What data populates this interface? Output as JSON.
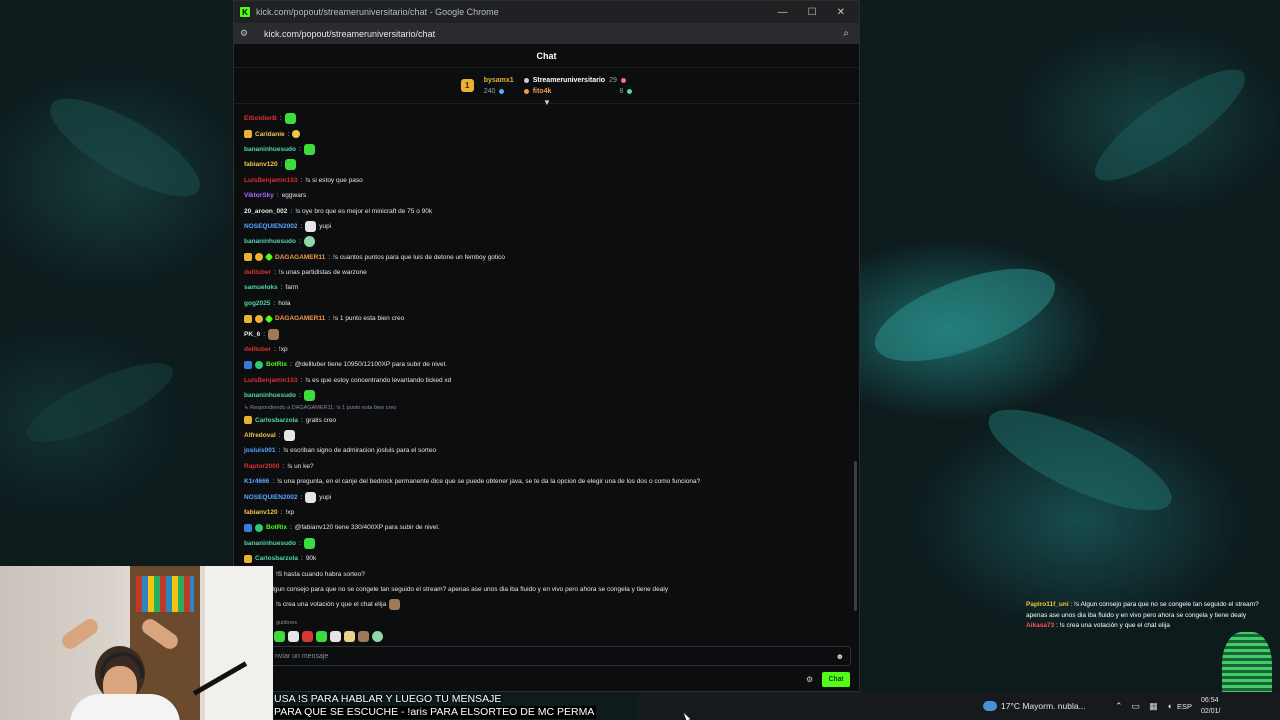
{
  "window": {
    "title": "kick.com/popout/streameruniversitario/chat - Google Chrome",
    "url": "kick.com/popout/streameruniversitario/chat",
    "logo_letter": "K",
    "min": "—",
    "max": "☐",
    "close": "✕"
  },
  "chat": {
    "title": "Chat",
    "leaderboard": {
      "rank": "1",
      "first_name": "bysamx1",
      "first_points": "240",
      "second_name": "Streameruniversitario",
      "second_points": "29",
      "third_name": "fito4k",
      "third_points": "8"
    },
    "messages": [
      {
        "user": "ElSoldierB",
        "color": "#e0302f",
        "text": "",
        "emote": "e-green"
      },
      {
        "user": "Caridanie",
        "color": "#f2c744",
        "text": "",
        "emote": "e-yellow",
        "badges": [
          "b-crown"
        ]
      },
      {
        "user": "bananinhuesudo",
        "color": "#53d6a8",
        "text": "",
        "emote": "e-green"
      },
      {
        "user": "fabianv120",
        "color": "#f2c744",
        "text": "",
        "emote": "e-green"
      },
      {
        "user": "LuisBenjamin103",
        "color": "#e0302f",
        "text": "!s si estoy que paso"
      },
      {
        "user": "ViktorSky",
        "color": "#b36bff",
        "text": "eggwars"
      },
      {
        "user": "20_aroon_002",
        "color": "#e6e6e6",
        "text": "!s oye bro que es mejor el minicraft de 75 o 90k"
      },
      {
        "user": "NOSEQUIEN2002",
        "color": "#5aa8ff",
        "text": "yupi",
        "emote": "e-white"
      },
      {
        "user": "bananinhuesudo",
        "color": "#53d6a8",
        "text": "",
        "emote": "e-teal"
      },
      {
        "user": "DAGAGAMER11",
        "color": "#f2994a",
        "text": "!s cuantos puntos para que luis de detone un femboy gotico",
        "badges": [
          "b-crown",
          "b-coin",
          "b-green"
        ]
      },
      {
        "user": "dellluber",
        "color": "#e0302f",
        "text": "!s unas partidistas de warzone"
      },
      {
        "user": "samueloks",
        "color": "#53d6a8",
        "text": "farm"
      },
      {
        "user": "gog2025",
        "color": "#53d6a8",
        "text": "hola"
      },
      {
        "user": "DAGAGAMER11",
        "color": "#f2994a",
        "text": "!s 1 punto esta bien creo",
        "badges": [
          "b-crown",
          "b-coin",
          "b-green"
        ]
      },
      {
        "user": "PK_6",
        "color": "#e6e6e6",
        "text": "",
        "emote": "e-brown"
      },
      {
        "user": "dellluber",
        "color": "#e0302f",
        "text": "!xp"
      },
      {
        "user": "BotRix",
        "color": "#53fc18",
        "text": "@dellluber tiene 10950/12100XP para subir de nivel.",
        "badges": [
          "b-bot",
          "b-verified"
        ]
      },
      {
        "user": "LuisBenjamin103",
        "color": "#e0302f",
        "text": "!s es que estoy concentrando levantando ticked xd"
      },
      {
        "user": "bananinhuesudo",
        "color": "#53d6a8",
        "text": "",
        "emote": "e-green"
      },
      {
        "user": "Carlosbarzola",
        "color": "#53d6a8",
        "text": "gratis creo",
        "badges": [
          "b-crown"
        ],
        "reply": "Respondiendo a DAGAGAMER11: !s 1 punto esta bien creo"
      },
      {
        "user": "Alfredoval",
        "color": "#f2c744",
        "text": "",
        "emote": "e-white"
      },
      {
        "user": "josluis001",
        "color": "#5aa8ff",
        "text": "!s escriban signo de admiracion josluis para el sorteo"
      },
      {
        "user": "Raptor2000",
        "color": "#e0302f",
        "text": "!s un ke?"
      },
      {
        "user": "K1r4666",
        "color": "#5aa8ff",
        "text": "!s una pregunta, en el canje del bedrock permanente dice que se puede obtener java, se te da la opcion de elegir una de los dos o como funciona?"
      },
      {
        "user": "NOSEQUIEN2002",
        "color": "#5aa8ff",
        "text": "yupi",
        "emote": "e-white"
      },
      {
        "user": "fabianv120",
        "color": "#f2c744",
        "text": "!xp"
      },
      {
        "user": "BotRix",
        "color": "#53fc18",
        "text": "@fabianv120 tiene 330/400XP para subir de nivel.",
        "badges": [
          "b-bot",
          "b-verified"
        ]
      },
      {
        "user": "bananinhuesudo",
        "color": "#53d6a8",
        "text": "",
        "emote": "e-green"
      },
      {
        "user": "Carlosbarzola",
        "color": "#53d6a8",
        "text": "90k",
        "badges": [
          "b-crown"
        ]
      },
      {
        "user": "",
        "color": "#e6e6e6",
        "text": "!S hasta cuando habra sorteo?"
      },
      {
        "user": "uni",
        "color": "#e6e6e6",
        "text": "!s Algun consejo para que no se congele tan seguido el stream? apenas ase unos dia iba fluido y en vivo pero ahora se congela y tiene dealy"
      },
      {
        "user": "",
        "color": "#e6e6e6",
        "text": "!s crea una votación y que el chat elija",
        "emote": "e-brown"
      }
    ],
    "followers_label": "guidores",
    "input_placeholder": "nviar un mensaje",
    "send_label": "Chat"
  },
  "overlay": {
    "line1": "USA !S PARA HABLAR Y LUEGO TU MENSAJE",
    "line2": "PARA QUE SE ESCUCHE - !aris PARA ELSORTEO DE MC PERMA"
  },
  "side_chat": {
    "user1": "Papiro11f_uni",
    "text1": "!s Algun consejo para que no se congele tan seguido el stream? apenas ase unos dia iba fluido y en vivo pero ahora se congela y tiene dealy",
    "user2": "Aikasa73",
    "text2": "!s crea una votación y que el chat elija"
  },
  "taskbar": {
    "weather": "17°C  Mayorm. nubla...",
    "lang": "ESP",
    "time": "06:54",
    "date": "02/01/"
  }
}
